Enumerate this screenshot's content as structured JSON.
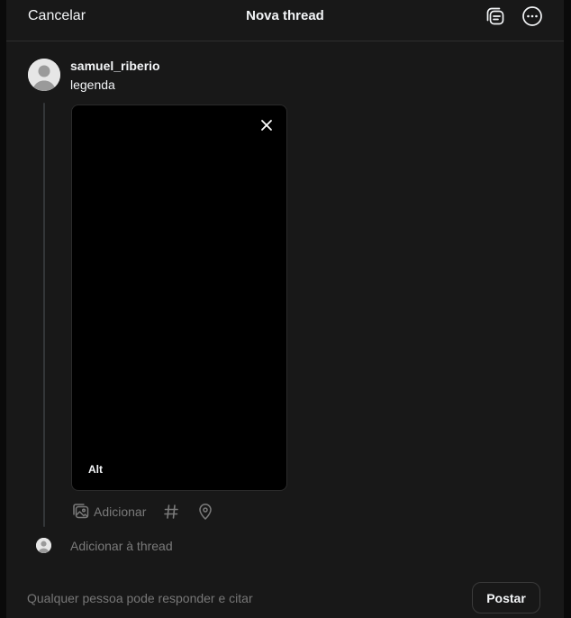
{
  "header": {
    "cancel_label": "Cancelar",
    "title": "Nova thread",
    "drafts_icon": "drafts-icon",
    "more_icon": "more-options-icon"
  },
  "post": {
    "username": "samuel_riberio",
    "caption": "legenda",
    "media": {
      "alt_label": "Alt",
      "close_icon": "close-icon"
    },
    "toolbar": {
      "add_media_label": "Adicionar",
      "add_media_icon": "image-icon",
      "hashtag_icon": "hashtag-icon",
      "location_icon": "location-pin-icon"
    }
  },
  "add_thread_label": "Adicionar à thread",
  "footer": {
    "reply_setting": "Qualquer pessoa pode responder e citar",
    "post_label": "Postar"
  },
  "colors": {
    "background": "#181818",
    "text": "#f3f5f7",
    "muted": "#7a7a7a"
  }
}
